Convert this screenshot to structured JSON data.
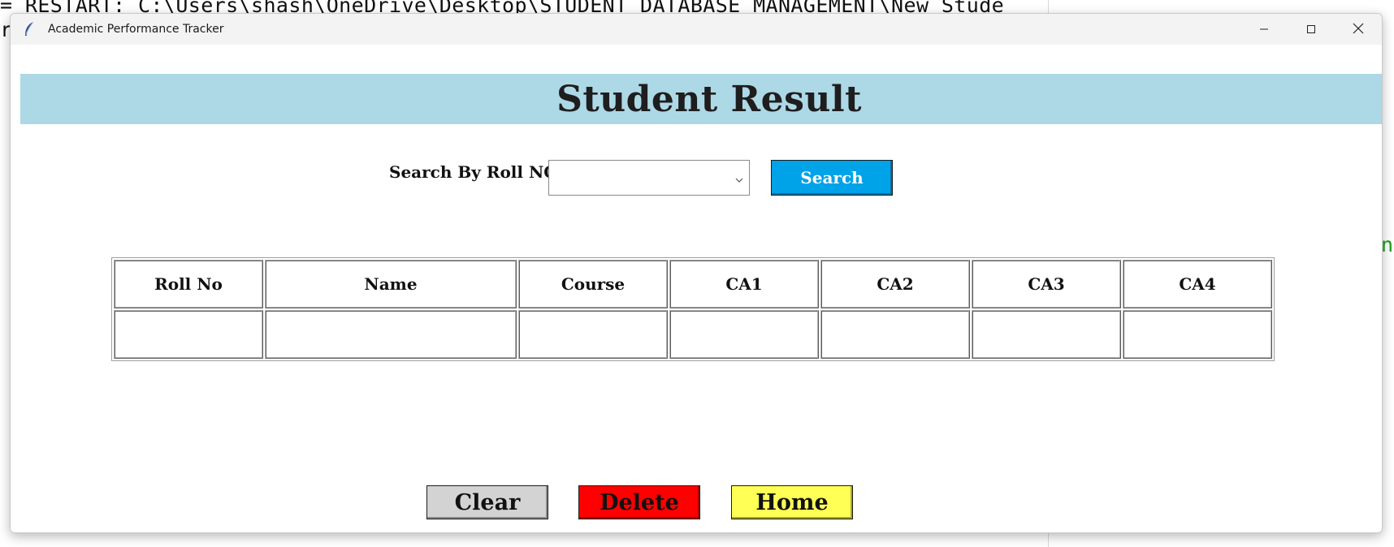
{
  "background": {
    "shell_line1": "= RESTART: C:\\Users\\shash\\OneDrive\\Desktop\\STUDENT DATABASE MANAGEMENT\\New Stude",
    "shell_line2": "r",
    "shell_side_char": "n"
  },
  "window": {
    "title": "Academic Performance Tracker",
    "icon": "feather-icon",
    "controls": [
      "minimize-icon",
      "maximize-icon",
      "close-icon"
    ]
  },
  "header": {
    "title": "Student Result",
    "band_color": "#add8e6"
  },
  "search": {
    "label": "Search By Roll NO",
    "selected_value": "",
    "button_label": "Search",
    "button_color": "#00a2e8"
  },
  "table": {
    "columns": [
      "Roll No",
      "Name",
      "Course",
      "CA1",
      "CA2",
      "CA3",
      "CA4"
    ],
    "rows": [
      [
        "",
        "",
        "",
        "",
        "",
        "",
        ""
      ]
    ]
  },
  "actions": {
    "clear_label": "Clear",
    "delete_label": "Delete",
    "home_label": "Home",
    "clear_color": "#d3d3d3",
    "delete_color": "#ff0000",
    "home_color": "#ffff55"
  }
}
